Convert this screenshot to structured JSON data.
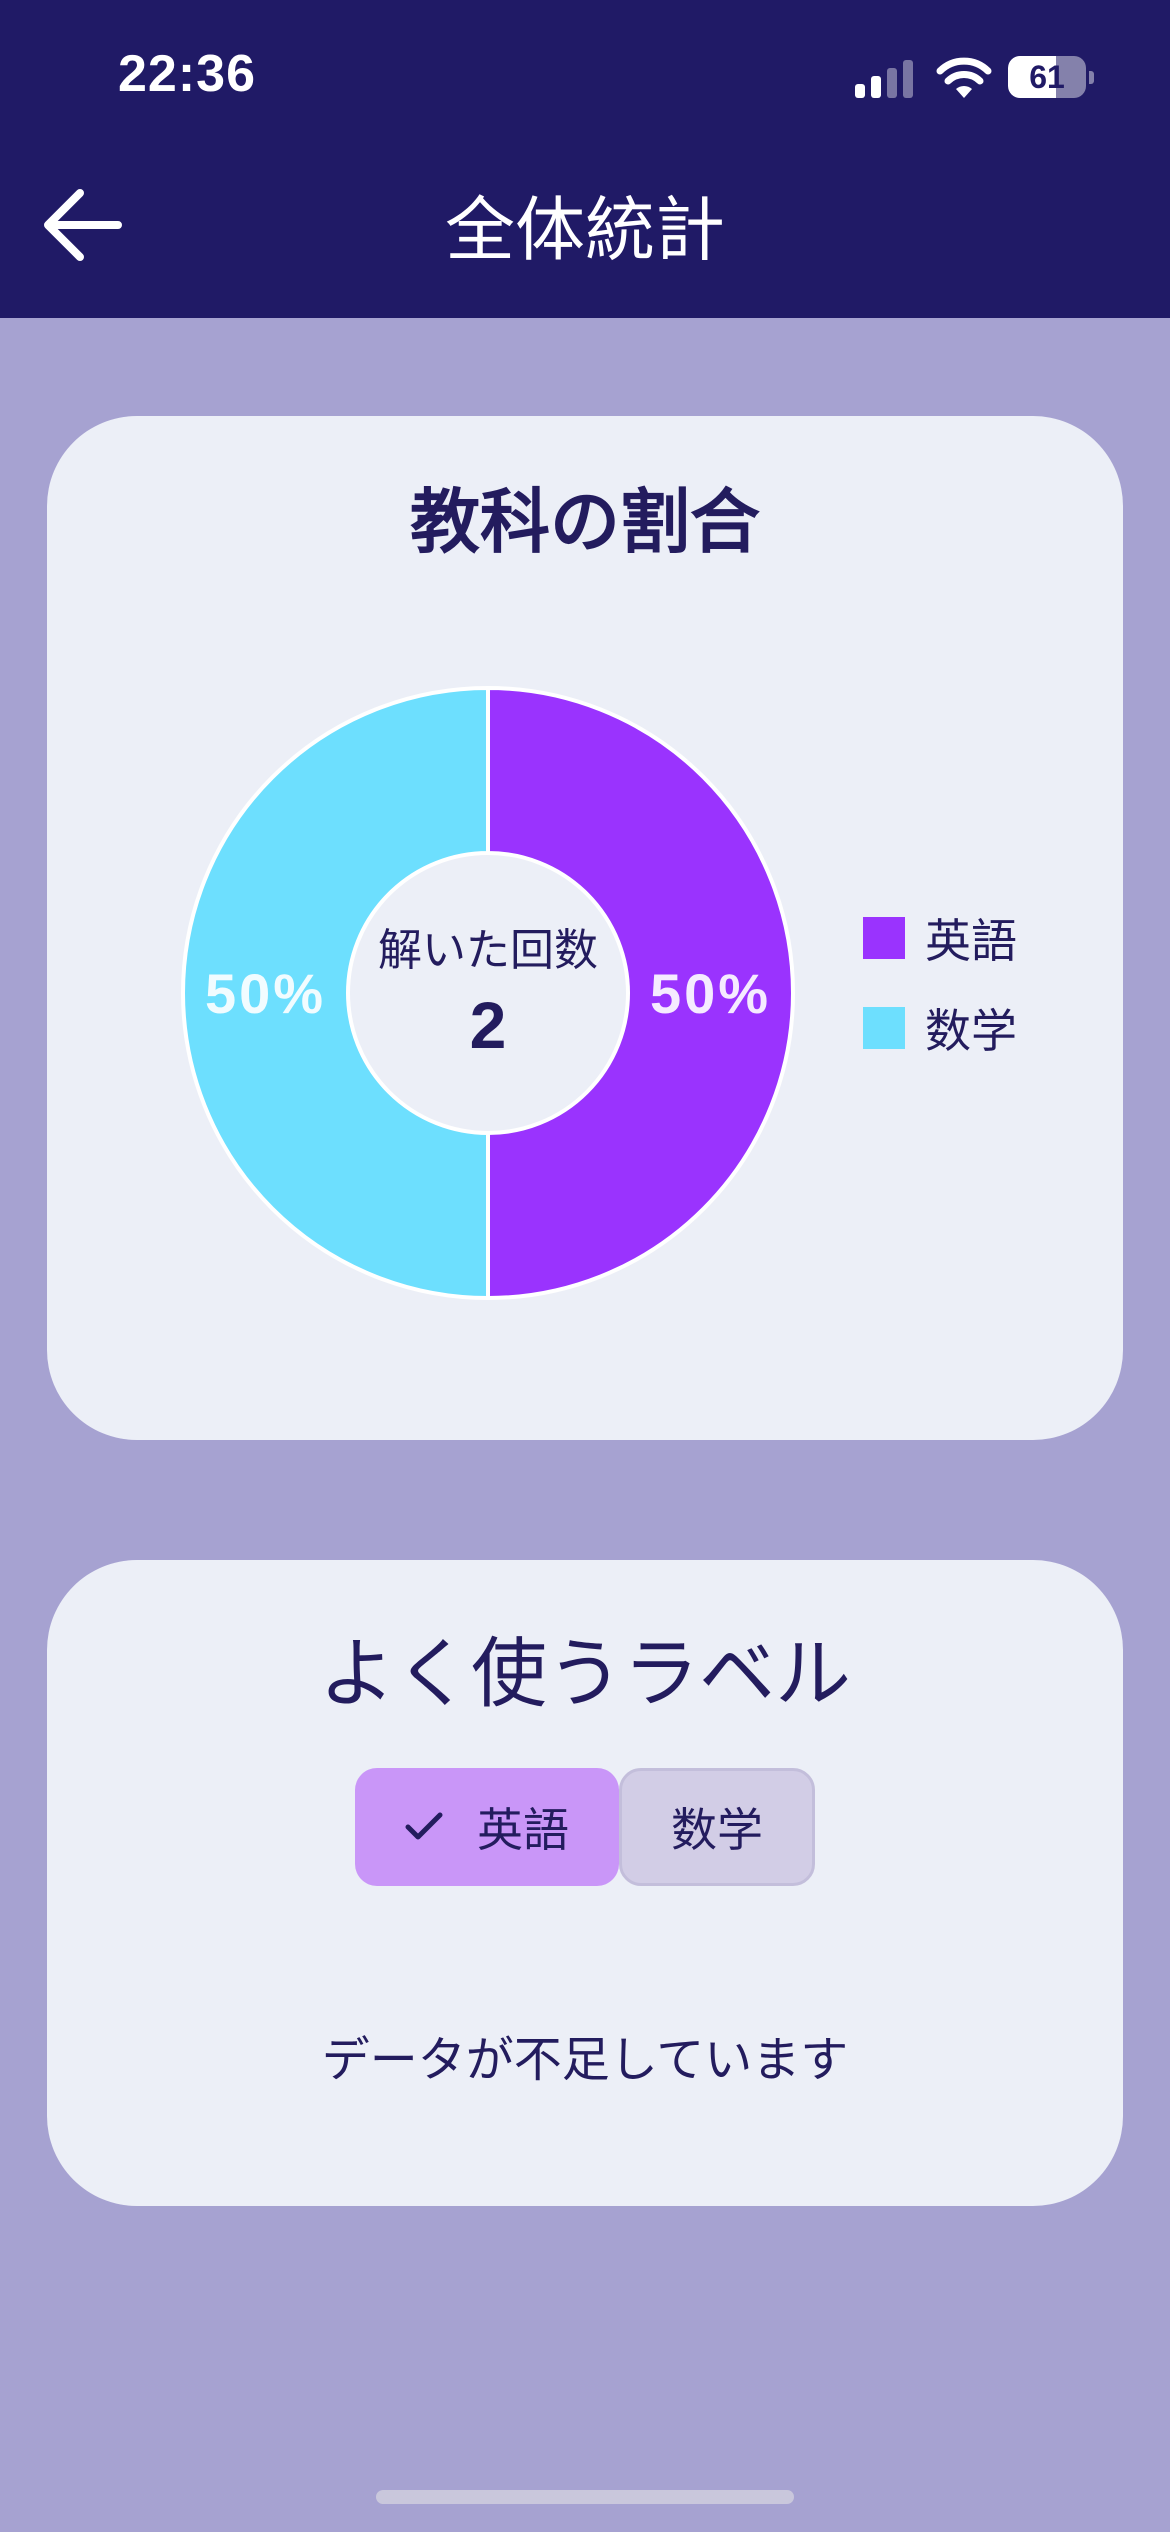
{
  "status_bar": {
    "time": "22:36",
    "battery_level": "61",
    "battery_fraction": 0.61,
    "signal_bars_active": 2,
    "signal_bars_total": 4
  },
  "header": {
    "title": "全体統計",
    "back_icon": "arrow-left-icon"
  },
  "subject_ratio": {
    "title": "教科の割合",
    "center_label": "解いた回数",
    "center_value": "2",
    "legend": [
      {
        "label": "英語",
        "color": "#9a33fe"
      },
      {
        "label": "数学",
        "color": "#6ddffe"
      }
    ]
  },
  "chart_data": {
    "type": "pie",
    "title": "教科の割合",
    "categories": [
      "英語",
      "数学"
    ],
    "values": [
      50,
      50
    ],
    "value_labels": [
      "50%",
      "50%"
    ],
    "colors": [
      "#9a33fe",
      "#6ddffe"
    ],
    "donut": true,
    "legend_position": "right"
  },
  "frequent_labels": {
    "title": "よく使うラベル",
    "chips": [
      {
        "label": "英語",
        "selected": true,
        "icon": "check-icon"
      },
      {
        "label": "数学",
        "selected": false
      }
    ],
    "empty_message": "データが不足しています"
  },
  "colors": {
    "header_bg": "#201a66",
    "page_bg": "#a6a2d1",
    "card_bg": "#eceff7",
    "text_dark": "#231c5e"
  }
}
